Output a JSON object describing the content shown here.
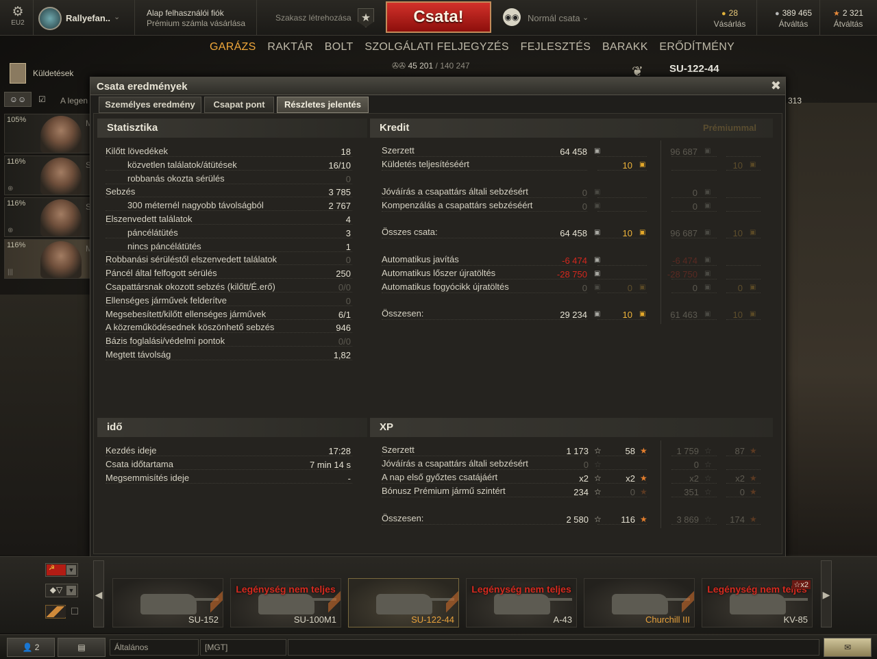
{
  "topbar": {
    "server": "EU2",
    "player": "Rallyefan..",
    "account_type": "Alap felhasználói fiók",
    "premium_buy": "Prémium számla vásárlása",
    "squad": "Szakasz létrehozása",
    "battle_button": "Csata!",
    "battle_mode": "Normál csata",
    "gold_value": "28",
    "gold_label": "Vásárlás",
    "credits_value": "389 465",
    "credits_label": "Átváltás",
    "freexp_value": "2 321",
    "freexp_label": "Átváltás"
  },
  "nav": {
    "items": [
      "GARÁZS",
      "RAKTÁR",
      "BOLT",
      "SZOLGÁLATI FELJEGYZÉS",
      "FEJLESZTÉS",
      "BARAKK",
      "ERŐDÍTMÉNY"
    ],
    "active": "GARÁZS"
  },
  "xp_progress": {
    "current": "45 201",
    "separator": "/",
    "total": "140 247"
  },
  "tank_title": "SU-122-44",
  "left": {
    "missions_label": "Küldetések",
    "crew_header_label": "A legen",
    "crew": [
      {
        "pct": "105%",
        "letter": "M"
      },
      {
        "pct": "116%",
        "letter": "S"
      },
      {
        "pct": "116%",
        "letter": "S"
      },
      {
        "pct": "116%",
        "letter": "M"
      }
    ]
  },
  "right_number": "313",
  "dialog": {
    "title": "Csata eredmények",
    "close": "✖",
    "tabs": [
      "Személyes eredmény",
      "Csapat pont",
      "Részletes jelentés"
    ],
    "active_tab": "Részletes jelentés",
    "stats": {
      "header": "Statisztika",
      "rows": [
        {
          "label": "Kilőtt lövedékek",
          "value": "18",
          "indent": false,
          "dim": false
        },
        {
          "label": "közvetlen találatok/átütések",
          "value": "16/10",
          "indent": true,
          "dim": false
        },
        {
          "label": "robbanás okozta sérülés",
          "value": "0",
          "indent": true,
          "dim": true
        },
        {
          "label": "Sebzés",
          "value": "3 785",
          "indent": false,
          "dim": false
        },
        {
          "label": "300 méternél nagyobb távolságból",
          "value": "2 767",
          "indent": true,
          "dim": false
        },
        {
          "label": "Elszenvedett találatok",
          "value": "4",
          "indent": false,
          "dim": false
        },
        {
          "label": "páncélátütés",
          "value": "3",
          "indent": true,
          "dim": false
        },
        {
          "label": "nincs páncélátütés",
          "value": "1",
          "indent": true,
          "dim": false
        },
        {
          "label": "Robbanási sérüléstől elszenvedett találatok",
          "value": "0",
          "indent": false,
          "dim": true
        },
        {
          "label": "Páncél által felfogott sérülés",
          "value": "250",
          "indent": false,
          "dim": false
        },
        {
          "label": "Csapattársnak okozott sebzés (kilőtt/É.erő)",
          "value": "0/0",
          "indent": false,
          "dim": true
        },
        {
          "label": "Ellenséges járművek felderítve",
          "value": "0",
          "indent": false,
          "dim": true
        },
        {
          "label": "Megsebesített/kilőtt ellenséges járművek",
          "value": "6/1",
          "indent": false,
          "dim": false
        },
        {
          "label": "A közreműködésednek köszönhető sebzés",
          "value": "946",
          "indent": false,
          "dim": false
        },
        {
          "label": "Bázis foglalási/védelmi pontok",
          "value": "0/0",
          "indent": false,
          "dim": true
        },
        {
          "label": "Megtett távolság",
          "value": "1,82",
          "indent": false,
          "dim": false
        }
      ]
    },
    "time": {
      "header": "idő",
      "rows": [
        {
          "label": "Kezdés ideje",
          "value": "17:28"
        },
        {
          "label": "Csata időtartama",
          "value": "7 min 14 s"
        },
        {
          "label": "Megsemmisítés ideje",
          "value": "-"
        }
      ]
    },
    "credit": {
      "header": "Kredit",
      "premium_header": "Prémiummal",
      "rows": [
        {
          "label": "Szerzett",
          "c": "64 458",
          "g": "",
          "pc": "96 687",
          "pg": ""
        },
        {
          "label": "Küldetés teljesítéséért",
          "c": "",
          "g": "10",
          "pc": "",
          "pg": "10"
        },
        {
          "label": "Jóváírás a csapattárs általi sebzésért",
          "c": "0",
          "g": "",
          "pc": "0",
          "pg": ""
        },
        {
          "label": "Kompenzálás a csapattárs sebzéséért",
          "c": "0",
          "g": "",
          "pc": "0",
          "pg": ""
        },
        {
          "label": "Összes csata:",
          "c": "64 458",
          "g": "10",
          "pc": "96 687",
          "pg": "10"
        },
        {
          "label": "Automatikus javítás",
          "c": "-6 474",
          "g": "",
          "pc": "-6 474",
          "pg": ""
        },
        {
          "label": "Automatikus lőszer újratöltés",
          "c": "-28 750",
          "g": "",
          "pc": "-28 750",
          "pg": ""
        },
        {
          "label": "Automatikus fogyócikk újratöltés",
          "c": "0",
          "g": "0",
          "pc": "0",
          "pg": "0"
        },
        {
          "label": "Összesen:",
          "c": "29 234",
          "g": "10",
          "pc": "61 463",
          "pg": "10"
        }
      ]
    },
    "xp": {
      "header": "XP",
      "rows": [
        {
          "label": "Szerzett",
          "x": "1 173",
          "f": "58",
          "px": "1 759",
          "pf": "87"
        },
        {
          "label": "Jóváírás a csapattárs általi sebzésért",
          "x": "0",
          "f": "",
          "px": "0",
          "pf": ""
        },
        {
          "label": "A nap első győztes csatájáért",
          "x": "x2",
          "f": "x2",
          "px": "x2",
          "pf": "x2"
        },
        {
          "label": "Bónusz Prémium jármű szintért",
          "x": "234",
          "f": "0",
          "px": "351",
          "pf": "0"
        },
        {
          "label": "Összesen:",
          "x": "2 580",
          "f": "116",
          "px": "3 869",
          "pf": "174"
        }
      ]
    }
  },
  "carousel": {
    "tanks": [
      {
        "name": "SU-152",
        "warning": "",
        "premium": false,
        "selected": false
      },
      {
        "name": "SU-100M1",
        "warning": "Legénység nem teljes",
        "premium": false,
        "selected": false
      },
      {
        "name": "SU-122-44",
        "warning": "",
        "premium": true,
        "selected": true
      },
      {
        "name": "A-43",
        "warning": "Legénység nem teljes",
        "premium": false,
        "selected": false
      },
      {
        "name": "Churchill III",
        "warning": "",
        "premium": true,
        "selected": false
      },
      {
        "name": "KV-85",
        "warning": "Legénység nem teljes",
        "premium": false,
        "selected": false,
        "badge": "☆x2"
      }
    ]
  },
  "bottombar": {
    "friends_count": "2",
    "chat_channel": "Általános",
    "clan_channel": "[MGT]"
  },
  "colors": {
    "accent_orange": "#f1a83b",
    "battle_red": "#c0221c",
    "warning_red": "#d62a1f",
    "gold": "#efb53b"
  }
}
